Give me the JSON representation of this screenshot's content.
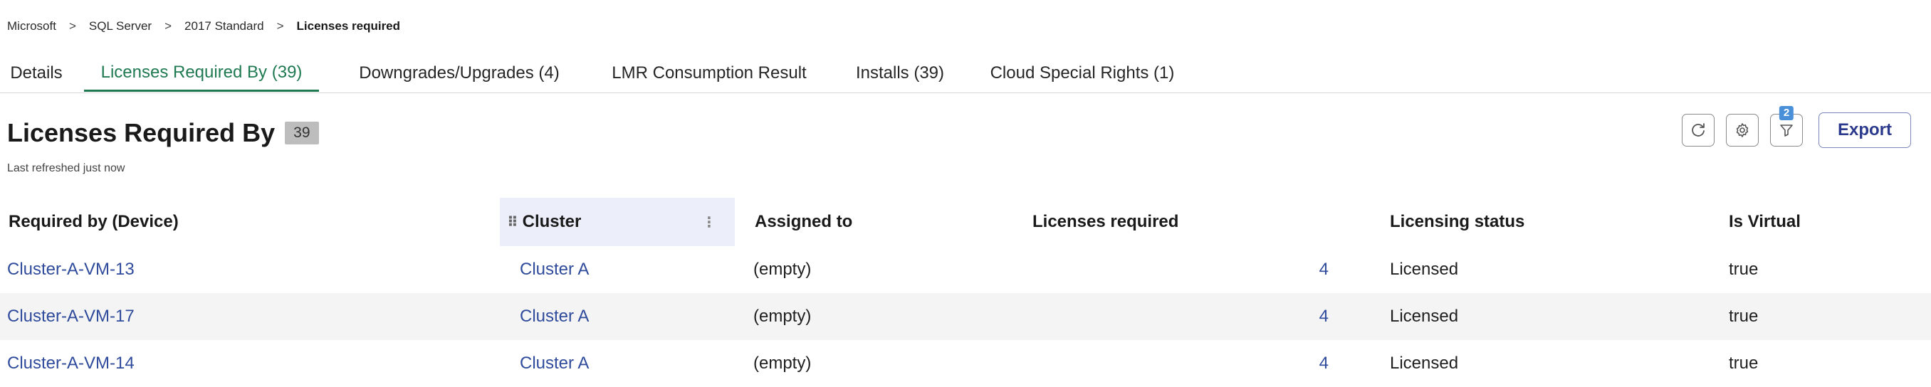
{
  "breadcrumb": {
    "items": [
      "Microsoft",
      "SQL Server",
      "2017 Standard"
    ],
    "current": "Licenses required",
    "separator": ">"
  },
  "tabs": [
    {
      "label": "Details",
      "active": false
    },
    {
      "label": "Licenses Required By (39)",
      "active": true
    },
    {
      "label": "Downgrades/Upgrades (4)",
      "active": false
    },
    {
      "label": "LMR Consumption Result",
      "active": false
    },
    {
      "label": "Installs (39)",
      "active": false
    },
    {
      "label": "Cloud Special Rights (1)",
      "active": false
    }
  ],
  "section": {
    "title": "Licenses Required By",
    "count": "39",
    "refreshed": "Last refreshed just now"
  },
  "toolbar": {
    "refresh_icon": "refresh-icon",
    "settings_icon": "gear-icon",
    "filter_icon": "filter-icon",
    "filter_count": "2",
    "export_label": "Export"
  },
  "table": {
    "columns": [
      "Required by (Device)",
      "Cluster",
      "Assigned to",
      "Licenses required",
      "Licensing status",
      "Is Virtual"
    ],
    "rows": [
      {
        "device": "Cluster-A-VM-13",
        "cluster": "Cluster A",
        "assigned": "(empty)",
        "licenses": "4",
        "status": "Licensed",
        "virtual": "true"
      },
      {
        "device": "Cluster-A-VM-17",
        "cluster": "Cluster A",
        "assigned": "(empty)",
        "licenses": "4",
        "status": "Licensed",
        "virtual": "true"
      },
      {
        "device": "Cluster-A-VM-14",
        "cluster": "Cluster A",
        "assigned": "(empty)",
        "licenses": "4",
        "status": "Licensed",
        "virtual": "true"
      }
    ]
  },
  "colors": {
    "active_tab": "#1f7a52",
    "link": "#2f4b9b",
    "filter_badge": "#4a90d9"
  }
}
